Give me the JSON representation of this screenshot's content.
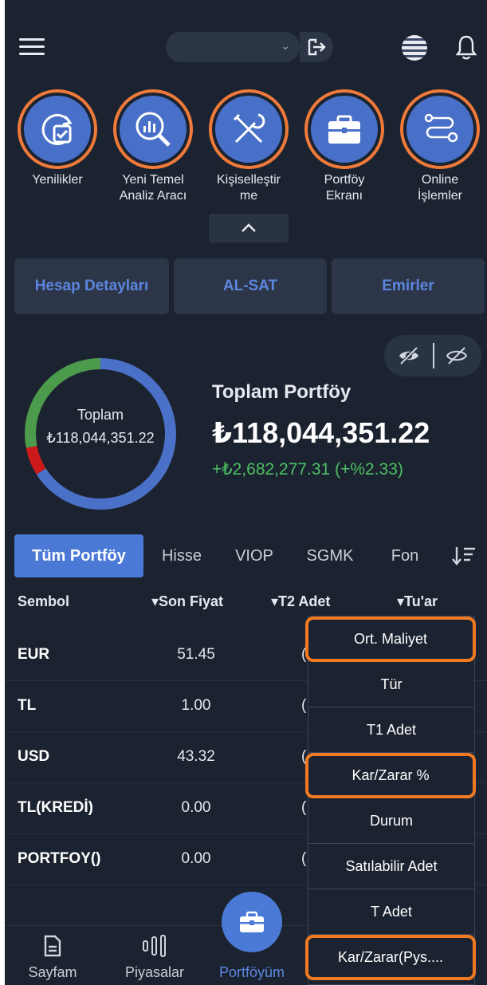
{
  "header": {
    "account_selected": "",
    "icons": [
      "menu-icon",
      "chevron-down-icon",
      "logout-icon",
      "globe-icon",
      "bell-icon"
    ]
  },
  "shortcuts": [
    {
      "label": "Yenilikler",
      "icon": "refresh-check-icon"
    },
    {
      "label": "Yeni Temel Analiz Aracı",
      "icon": "chart-search-icon"
    },
    {
      "label": "Kişiselleştirme",
      "icon": "tools-icon"
    },
    {
      "label": "Portföy Ekranı",
      "icon": "briefcase-icon"
    },
    {
      "label": "Online İşlemler",
      "icon": "flow-icon"
    }
  ],
  "shortcut_labels": {
    "yenilikler": "Yenilikler",
    "analiz_1": "Yeni Temel",
    "analiz_2": "Analiz Aracı",
    "kisisel_1": "Kişiselleştir",
    "kisisel_2": "me",
    "portfoy_1": "Portföy",
    "portfoy_2": "Ekranı",
    "online_1": "Online",
    "online_2": "İşlemler"
  },
  "actions": {
    "hesap": "Hesap Detayları",
    "alsat": "AL-SAT",
    "emirler": "Emirler"
  },
  "summary": {
    "donut_label": "Toplam",
    "donut_value": "₺118,044,351.22",
    "title": "Toplam Portföy",
    "total": "₺118,044,351.22",
    "change": "+₺2,682,277.31 (+%2.33)",
    "allocation": [
      {
        "color": "#4a70c8",
        "fraction": 0.66
      },
      {
        "color": "#cc1a1a",
        "fraction": 0.06
      },
      {
        "color": "#4c9a4c",
        "fraction": 0.28
      }
    ]
  },
  "tabs": [
    "Tüm Portföy",
    "Hisse",
    "VIOP",
    "SGMK",
    "Fon"
  ],
  "table": {
    "headers": {
      "sembol": "Sembol",
      "son_fiyat": "▾Son Fiyat",
      "t2_adet": "▾T2 Adet",
      "tutar": "▾Tu'ar"
    },
    "rows": [
      {
        "symbol": "EUR",
        "price": "51.45",
        "peek": "("
      },
      {
        "symbol": "TL",
        "price": "1.00",
        "peek": "("
      },
      {
        "symbol": "USD",
        "price": "43.32",
        "peek": "("
      },
      {
        "symbol": "TL(KREDİ)",
        "price": "0.00",
        "peek": "("
      },
      {
        "symbol": "PORTFOY()",
        "price": "0.00",
        "peek": "("
      }
    ]
  },
  "menu": [
    {
      "label": "Ort. Maliyet",
      "highlighted": true
    },
    {
      "label": "Tür",
      "highlighted": false
    },
    {
      "label": "T1 Adet",
      "highlighted": false
    },
    {
      "label": "Kar/Zarar %",
      "highlighted": true
    },
    {
      "label": "Durum",
      "highlighted": false
    },
    {
      "label": "Satılabilir Adet",
      "highlighted": false
    },
    {
      "label": "T Adet",
      "highlighted": false
    },
    {
      "label": "Kar/Zarar(Pys....",
      "highlighted": true
    }
  ],
  "bottom_nav": {
    "sayfam": "Sayfam",
    "piyasalar": "Piyasalar",
    "portfoyum": "Portföyüm"
  },
  "colors": {
    "background": "#1c2330",
    "accent": "#4a7ad6",
    "ring": "#f07a3a",
    "highlight": "#f07a22",
    "gain": "#4cc064"
  }
}
